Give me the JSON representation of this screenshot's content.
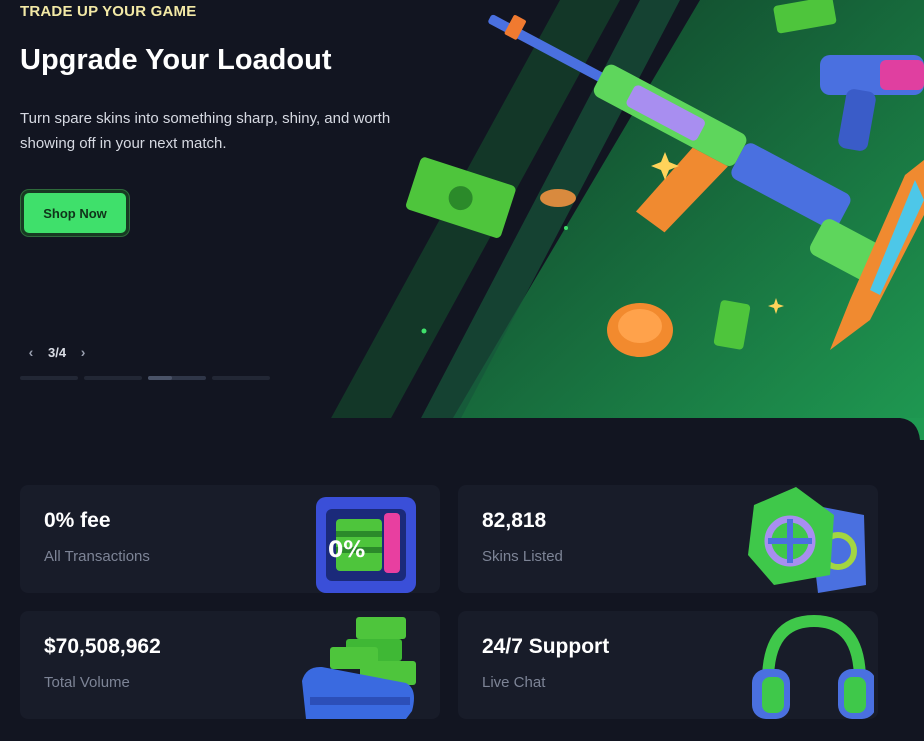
{
  "hero": {
    "eyebrow": "TRADE UP YOUR GAME",
    "title": "Upgrade Your Loadout",
    "subtitle": "Turn spare skins into something sharp, shiny, and worth showing off in your next match.",
    "cta_label": "Shop Now",
    "pager": {
      "prev_icon": "chevron-left-icon",
      "next_icon": "chevron-right-icon",
      "text": "3/4",
      "current": 3,
      "total": 4
    }
  },
  "stats": [
    {
      "value": "0% fee",
      "label": "All Transactions",
      "icon": "safe-with-cash-icon"
    },
    {
      "value": "82,818",
      "label": "Skins Listed",
      "icon": "skin-tags-icon"
    },
    {
      "value": "$70,508,962",
      "label": "Total Volume",
      "icon": "magazine-with-cash-icon"
    },
    {
      "value": "24/7 Support",
      "label": "Live Chat",
      "icon": "headphones-icon"
    }
  ],
  "colors": {
    "background": "#121521",
    "card": "#181c29",
    "accent_green": "#3fe06b",
    "eyebrow": "#f3e9a6",
    "muted_text": "#7d8496"
  }
}
